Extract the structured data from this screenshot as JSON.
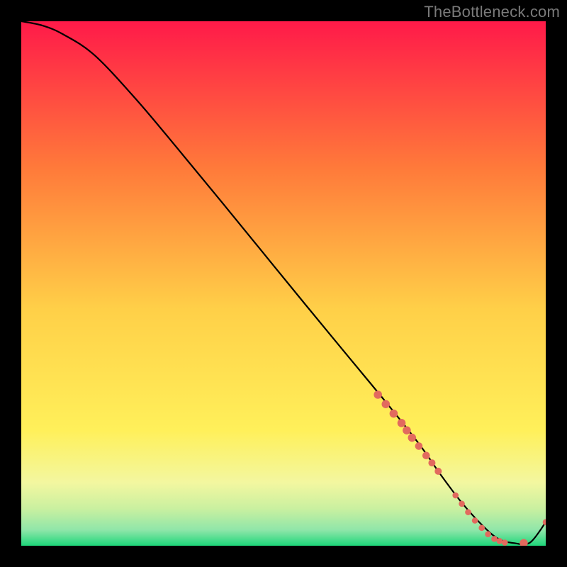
{
  "watermark": "TheBottleneck.com",
  "colors": {
    "background": "#000000",
    "curve_stroke": "#000000",
    "point_fill": "#e26a5e",
    "gradient_top": "#ff1a49",
    "gradient_mid1": "#ff7a3a",
    "gradient_mid2": "#ffd048",
    "gradient_mid3": "#fff05a",
    "gradient_band1": "#f3f7a0",
    "gradient_band2": "#c9f0a0",
    "gradient_band3": "#8fe6a9",
    "gradient_bottom": "#1ed67a"
  },
  "chart_data": {
    "type": "line",
    "title": "",
    "xlabel": "",
    "ylabel": "",
    "xlim": [
      0,
      100
    ],
    "ylim": [
      0,
      100
    ],
    "series": [
      {
        "name": "curve",
        "x": [
          0,
          4,
          8,
          14,
          22,
          30,
          38,
          46,
          54,
          62,
          70,
          76,
          80,
          84,
          88,
          91,
          94,
          97,
          100
        ],
        "values": [
          100,
          99.2,
          97.5,
          93.5,
          85,
          75.5,
          65.8,
          56,
          46.2,
          36.5,
          26.8,
          19.2,
          13.5,
          8.2,
          3.8,
          1.3,
          0.5,
          0.6,
          4.5
        ]
      }
    ],
    "points": {
      "name": "markers",
      "x": [
        68,
        69.5,
        71,
        72.5,
        73.5,
        74.5,
        75.8,
        77.2,
        78.3,
        79.5,
        82.8,
        84,
        85.2,
        86.5,
        87.8,
        89,
        90.2,
        91.2,
        92.2,
        95.8,
        100
      ],
      "values": [
        28.8,
        27,
        25.2,
        23.4,
        22,
        20.6,
        19,
        17.2,
        15.8,
        14.2,
        9.6,
        8,
        6.4,
        4.8,
        3.4,
        2.2,
        1.3,
        0.9,
        0.6,
        0.5,
        4.5
      ],
      "radius": [
        5.8,
        5.8,
        5.8,
        5.8,
        5.8,
        5.8,
        5.3,
        5.3,
        5,
        5,
        4.3,
        4.3,
        4.3,
        4.3,
        4.3,
        4.3,
        4.3,
        4.3,
        4.3,
        5.8,
        4.3
      ]
    }
  }
}
